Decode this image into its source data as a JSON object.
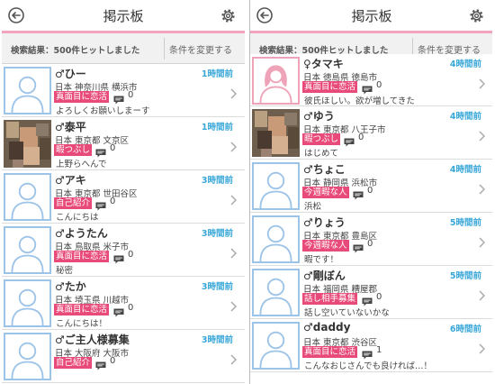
{
  "colors": {
    "accent_pink": "#f2a3bd",
    "tag_bg": "#e84a7a",
    "time_blue": "#3aa8d8",
    "avatar_blue": "#9cc3e8",
    "avatar_pink": "#efa3b8"
  },
  "left": {
    "header": {
      "title": "掲示板",
      "back_icon": "back-arrow-icon",
      "settings_icon": "gear-icon"
    },
    "result": {
      "text": "検索結果：500件ヒットしました",
      "change_label": "条件を変更する"
    },
    "posts": [
      {
        "name": "♂ひー",
        "location": "日本 神奈川県 横浜市",
        "tag": "真面目に恋活",
        "comments": "0",
        "message": "よろしくお願いしまーす",
        "time": "1時間前",
        "avatar": "male"
      },
      {
        "name": "♂泰平",
        "location": "日本 東京都 文京区",
        "tag": "暇つぶし",
        "comments": "0",
        "message": "上野らへんで",
        "time": "1時間前",
        "avatar": "photo"
      },
      {
        "name": "♂アキ",
        "location": "日本 東京都 世田谷区",
        "tag": "自己紹介",
        "comments": "0",
        "message": "こんにちは",
        "time": "3時間前",
        "avatar": "male"
      },
      {
        "name": "♂ようたん",
        "location": "日本 鳥取県 米子市",
        "tag": "真面目に恋活",
        "comments": "0",
        "message": "秘密",
        "time": "3時間前",
        "avatar": "male"
      },
      {
        "name": "♂たか",
        "location": "日本 埼玉県 川越市",
        "tag": "真面目に恋活",
        "comments": "0",
        "message": "こんにちは！",
        "time": "3時間前",
        "avatar": "male"
      },
      {
        "name": "♂ご主人様募集",
        "location": "日本 大阪府 大阪市",
        "tag": "自己紹介",
        "comments": "0",
        "message": "",
        "time": "3時間前",
        "avatar": "male"
      }
    ]
  },
  "right": {
    "header": {
      "title": "掲示板",
      "back_icon": "back-arrow-icon",
      "settings_icon": "gear-icon"
    },
    "result": {
      "text": "検索結果：500件ヒットしました",
      "change_label": "条件を変更する"
    },
    "posts": [
      {
        "name": "♀タマキ",
        "location": "日本 徳島県 徳島市",
        "tag": "真面目に恋活",
        "comments": "0",
        "message": "彼氏ほしい。欲が増してきた",
        "time": "4時間前",
        "avatar": "female"
      },
      {
        "name": "♂ゆう",
        "location": "日本 東京都 八王子市",
        "tag": "暇つぶし",
        "comments": "0",
        "message": "はじめて",
        "time": "4時間前",
        "avatar": "photo"
      },
      {
        "name": "♂ちょこ",
        "location": "日本 静岡県 浜松市",
        "tag": "今週暇な人",
        "comments": "0",
        "message": "浜松",
        "time": "4時間前",
        "avatar": "male"
      },
      {
        "name": "♂りょう",
        "location": "日本 東京都 豊島区",
        "tag": "今週暇な人",
        "comments": "0",
        "message": "暇です！",
        "time": "5時間前",
        "avatar": "male"
      },
      {
        "name": "♂剛ぼん",
        "location": "日本 福岡県 糟屋郡",
        "tag": "話し相手募集",
        "comments": "0",
        "message": "話し空いていないかな",
        "time": "5時間前",
        "avatar": "male"
      },
      {
        "name": "♂daddy",
        "location": "日本 東京都 渋谷区",
        "tag": "真面目に恋活",
        "comments": "1",
        "message": "こんなおじさんでも良ければ…！",
        "time": "6時間前",
        "avatar": "male"
      }
    ]
  }
}
